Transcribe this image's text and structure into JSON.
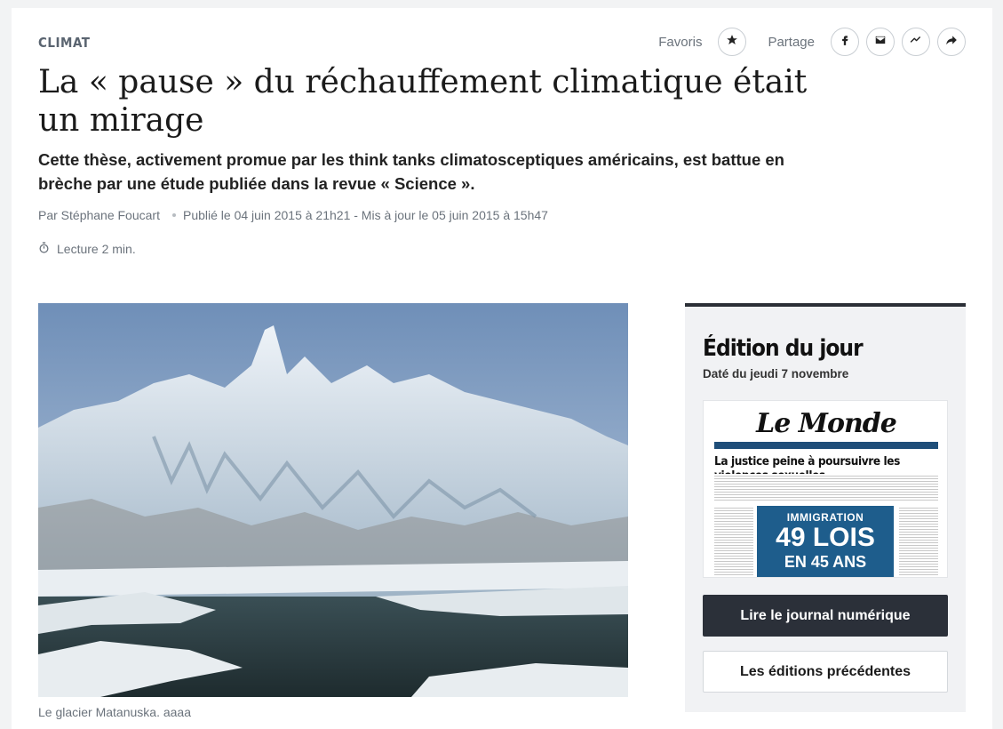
{
  "article": {
    "rubric": "CLIMAT",
    "title": "La « pause » du réchauffement climatique était un mirage",
    "standfirst": "Cette thèse, activement promue par les think tanks climatosceptiques américains, est battue en brèche par une étude publiée dans la revue « Science ».",
    "author": "Par Stéphane Foucart",
    "published": "Publié le 04 juin 2015 à 21h21 - Mis à jour le 05 juin 2015 à 15h47",
    "reading_time": "Lecture 2 min.",
    "image_caption": "Le glacier Matanuska. aaaa"
  },
  "actions": {
    "favorites_label": "Favoris",
    "share_label": "Partage",
    "icons": [
      "star-icon",
      "facebook-icon",
      "mail-icon",
      "messenger-icon",
      "share-arrow-icon"
    ]
  },
  "edition": {
    "title": "Édition du jour",
    "date": "Daté du jeudi 7 novembre",
    "cover": {
      "masthead": "Le Monde",
      "headline": "La justice peine à poursuivre les violences sexuelles",
      "box_kicker": "IMMIGRATION",
      "box_main": "49 LOIS",
      "box_sub": "EN 45 ANS"
    },
    "read_button": "Lire le journal numérique",
    "previous_button": "Les éditions précédentes"
  },
  "colors": {
    "accent_dark": "#2b3039",
    "meta_grey": "#6b737c",
    "cover_blue": "#1e5d8c"
  }
}
